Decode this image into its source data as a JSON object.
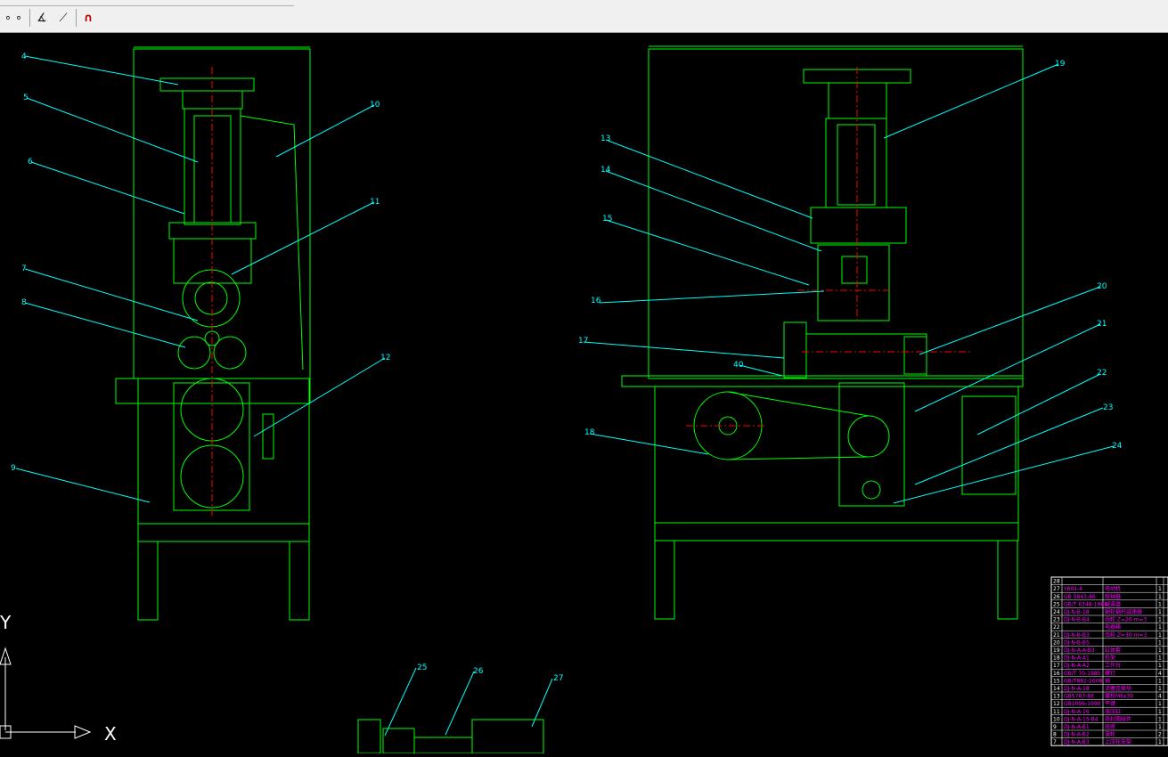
{
  "toolbar": {
    "tools": [
      {
        "name": "snap-icon",
        "glyph": "∘"
      },
      {
        "name": "dimension-icon",
        "glyph": "∡"
      },
      {
        "name": "match-properties-icon",
        "glyph": "⟋"
      },
      {
        "name": "magnet-icon",
        "glyph": "∩"
      }
    ]
  },
  "colors": {
    "background": "#000000",
    "geometry": "#00ff00",
    "leader": "#00ffff",
    "centerline": "#ff0000",
    "table_text": "#ff00ff",
    "axis": "#ffffff"
  },
  "axis": {
    "x_label": "X",
    "y_label": "Y"
  },
  "callouts": {
    "c4": "4",
    "c5": "5",
    "c6": "6",
    "c7": "7",
    "c8": "8",
    "c9": "9",
    "c10": "10",
    "c11": "11",
    "c12": "12",
    "c13": "13",
    "c14": "14",
    "c15": "15",
    "c16": "16",
    "c17": "17",
    "c18": "18",
    "c19": "19",
    "c20": "20",
    "c21": "21",
    "c22": "22",
    "c23": "23",
    "c24": "24",
    "c25": "25",
    "c26": "26",
    "c27": "27",
    "c40": "40"
  },
  "bom": {
    "rows": [
      {
        "no": "28",
        "code": "",
        "name": "",
        "qty": ""
      },
      {
        "no": "27",
        "code": "Y801-4",
        "name": "电动机",
        "qty": "1"
      },
      {
        "no": "26",
        "code": "GB 5843-86",
        "name": "联轴器",
        "qty": "1"
      },
      {
        "no": "25",
        "code": "GB/T 6348-1986",
        "name": "减速器",
        "qty": "1"
      },
      {
        "no": "24",
        "code": "DJ-N-B-18",
        "name": "蜗轮蜗杆减速器",
        "qty": "1"
      },
      {
        "no": "23",
        "code": "DJ-N-B-B4",
        "name": "齿轮 Z=26 m=3",
        "qty": "1"
      },
      {
        "no": "22",
        "code": "",
        "name": "电器箱",
        "qty": "1"
      },
      {
        "no": "21",
        "code": "DJ-N-B-B3",
        "name": "齿轮 Z=30 m=3",
        "qty": "1"
      },
      {
        "no": "20",
        "code": "DJ-N-B-B5",
        "name": "",
        "qty": "1"
      },
      {
        "no": "19",
        "code": "DJ-N-A-A-B3",
        "name": "缸体套",
        "qty": "1"
      },
      {
        "no": "18",
        "code": "DJ-N-A-A1",
        "name": "机架",
        "qty": "1"
      },
      {
        "no": "17",
        "code": "DJ-N-A-A2",
        "name": "工作台",
        "qty": "1"
      },
      {
        "no": "16",
        "code": "GB/T 70-1985",
        "name": "螺钉",
        "qty": "4"
      },
      {
        "no": "15",
        "code": "GB/T882-2008",
        "name": "销",
        "qty": "1"
      },
      {
        "no": "14",
        "code": "DJ-N-A-18",
        "name": "活塞连接块",
        "qty": "1"
      },
      {
        "no": "13",
        "code": "GB5783-86",
        "name": "螺栓M6x30",
        "qty": "4"
      },
      {
        "no": "12",
        "code": "GB1096-1990",
        "name": "平键",
        "qty": "1"
      },
      {
        "no": "11",
        "code": "DJ-N-A-16",
        "name": "液压缸",
        "qty": "1"
      },
      {
        "no": "10",
        "code": "DJ-N-A-15-B4",
        "name": "密封圈组件",
        "qty": "1"
      },
      {
        "no": "9",
        "code": "DJ-N-A-B1",
        "name": "底座",
        "qty": "1"
      },
      {
        "no": "8",
        "code": "DJ-N-A-B2",
        "name": "滚轮",
        "qty": "2"
      },
      {
        "no": "7",
        "code": "DJ-N-A-B3",
        "name": "上压轮支架",
        "qty": "1"
      }
    ]
  }
}
